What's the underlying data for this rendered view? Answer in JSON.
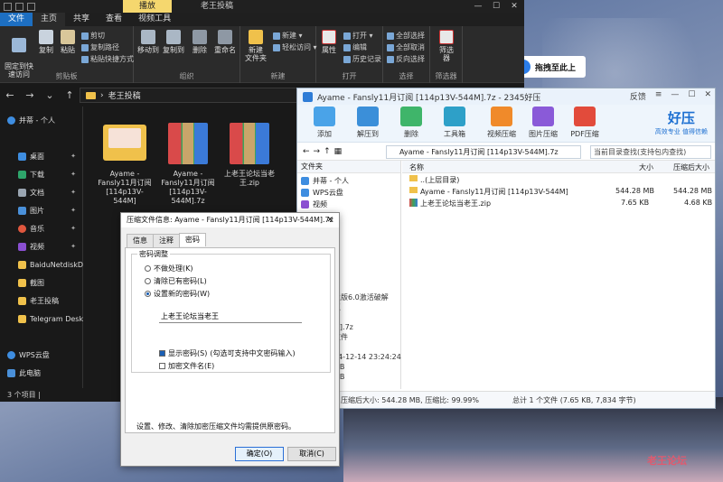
{
  "colors": {
    "folder": "#f0c14b",
    "accent": "#1d6fc2",
    "brand": "#1c6fd1",
    "ctx_tab": "#f5d76e"
  },
  "explorer": {
    "context_tab": "播放",
    "title": "老王投稿",
    "window_controls": [
      "—",
      "☐",
      "✕"
    ],
    "ribbon_tabs": [
      "文件",
      "主页",
      "共享",
      "查看",
      "视频工具"
    ],
    "ribbon": {
      "clipboard": {
        "label": "剪贴板",
        "pin": "固定到快\n速访问",
        "copy": "复制",
        "paste": "粘贴",
        "cut": "剪切",
        "copy_path": "复制路径",
        "paste_shortcut": "粘贴快捷方式"
      },
      "organize": {
        "label": "组织",
        "move_to": "移动到",
        "copy_to": "复制到",
        "delete": "删除",
        "rename": "重命名"
      },
      "new": {
        "label": "新建",
        "new_folder": "新建\n文件夹",
        "new_item": "新建 ▾",
        "easy_access": "轻松访问 ▾"
      },
      "open": {
        "label": "打开",
        "properties": "属性",
        "open": "打开 ▾",
        "edit": "编辑",
        "history": "历史记录"
      },
      "select": {
        "label": "选择",
        "select_all": "全部选择",
        "select_none": "全部取消",
        "invert": "反向选择"
      },
      "filter": {
        "label": "筛选器",
        "filter": "筛选\n器"
      }
    },
    "breadcrumb": "老王投稿",
    "nav_pane": [
      {
        "label": "并蒂 - 个人",
        "icon": "cloud-icon"
      },
      {
        "label": "桌面",
        "icon": "desktop-icon"
      },
      {
        "label": "下载",
        "icon": "download-icon"
      },
      {
        "label": "文档",
        "icon": "document-icon"
      },
      {
        "label": "图片",
        "icon": "picture-icon"
      },
      {
        "label": "音乐",
        "icon": "music-icon"
      },
      {
        "label": "视频",
        "icon": "video-icon"
      },
      {
        "label": "BaiduNetdiskD",
        "icon": "folder-icon"
      },
      {
        "label": "截图",
        "icon": "folder-icon"
      },
      {
        "label": "老王投稿",
        "icon": "folder-icon"
      },
      {
        "label": "Telegram Desk",
        "icon": "folder-icon"
      },
      {
        "label": "WPS云盘",
        "icon": "cloud-icon"
      },
      {
        "label": "此电脑",
        "icon": "computer-icon"
      }
    ],
    "files": [
      {
        "name": "Ayame - Fansly11月订阅 [114p13V-544M]",
        "type": "folder"
      },
      {
        "name": "Ayame - Fansly11月订阅 [114p13V-544M].7z",
        "type": "archive"
      },
      {
        "name": "上老王论坛当老王.zip",
        "type": "archive"
      }
    ],
    "status": "3 个项目 |"
  },
  "baidu_bubble": "拖拽至此上",
  "archive": {
    "title": "Ayame - Fansly11月订阅 [114p13V-544M].7z - 2345好压",
    "feedback": "反馈",
    "toolbar": [
      "添加",
      "解压到",
      "删除",
      "工具箱",
      "视频压缩",
      "图片压缩",
      "PDF压缩"
    ],
    "brand_name": "好压",
    "brand_slogan": "高效专业 值得信赖",
    "path": "Ayame - Fansly11月订阅 [114p13V-544M].7z",
    "search_placeholder": "当前目录查找(支持包内查找)",
    "tree_header": "文件夹",
    "tree": [
      "并蒂 - 个人",
      "WPS云盘",
      "视频",
      "图片"
    ],
    "list_headers": {
      "name": "名称",
      "size": "大小",
      "packed": "压缩后大小"
    },
    "rows": [
      {
        "name": "..(上层目录)",
        "size": "",
        "packed": ""
      },
      {
        "name": "Ayame - Fansly11月订阅 [114p13V-544M]",
        "size": "544.28 MB",
        "packed": "544.28 MB"
      },
      {
        "name": "上老王论坛当老王.zip",
        "size": "7.65 KB",
        "packed": "4.68 KB"
      }
    ],
    "info_lines": [
      "业版6.0激活破解",
      "王",
      "",
      "",
      "M].7z",
      "文件",
      "",
      "24-12-14 23:24:24",
      "MB",
      "MB"
    ],
    "status_left": "压缩后大小: 544.28 MB, 压缩比: 99.99%",
    "status_right": "总计 1 个文件 (7.65 KB, 7,834 字节)"
  },
  "dialog": {
    "title": "压缩文件信息: Ayame - Fansly11月订阅 [114p13V-544M].7z",
    "tabs": [
      "信息",
      "注释",
      "密码"
    ],
    "group_label": "密码调整",
    "options": [
      "不做处理(K)",
      "清除已有密码(L)",
      "设置新的密码(W)"
    ],
    "password": "上老王论坛当老王",
    "show_password": "显示密码(S)",
    "show_password_hint": "(勾选可支持中文密码输入)",
    "encrypt_names": "加密文件名(E)",
    "note": "设置、修改、清除加密压缩文件均需提供原密码。",
    "ok": "确定(O)",
    "cancel": "取消(C)"
  },
  "watermark": "老王论坛"
}
